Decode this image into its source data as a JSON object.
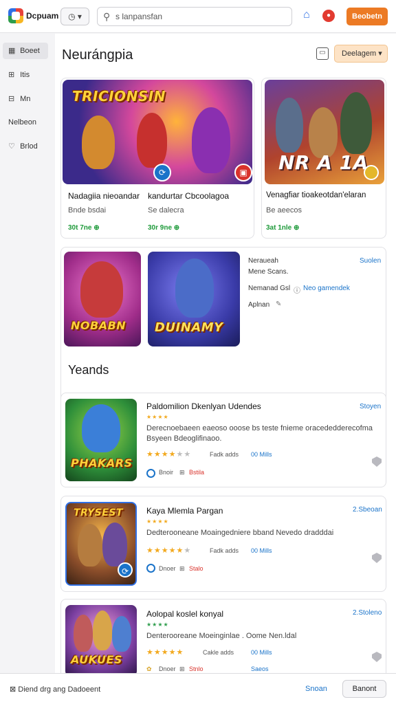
{
  "topbar": {
    "brand": "Dcpuam",
    "history_label": "◷ ▾",
    "search_placeholder": "s lanpansfan",
    "cta_label": "Beobetn"
  },
  "sidebar": {
    "items": [
      {
        "icon": "▦",
        "label": "Boeet"
      },
      {
        "icon": "⊞",
        "label": "Itis"
      },
      {
        "icon": "⊟",
        "label": "Mn"
      },
      {
        "icon": "",
        "label": "Nelbeon"
      },
      {
        "icon": "♡",
        "label": "Brlod"
      }
    ]
  },
  "main": {
    "title": "Neurángpia",
    "dropdown_label": "Deelagem ▾",
    "featured": [
      {
        "art_title": "TRICIONSIN",
        "name": "Nadagiia nieoandar",
        "dev": "Bnde bsdai",
        "price": "30t 7ne ⊕",
        "badge": "⟳"
      },
      {
        "art_title": "",
        "name": "kandurtar Cbcoolagoa",
        "dev": "Se dalecra",
        "price": "30r 9ne ⊕",
        "badge": "▣"
      },
      {
        "art_title": "NR A 1A",
        "name": "Venagfiar tioakeotdan'elaran",
        "dev": "Be aeecos",
        "price": "3at 1nle ⊕",
        "badge": ""
      }
    ],
    "promo": {
      "art1_title": "NOBABN",
      "art2_title": "DUINAMY",
      "info_title": "Neraueah",
      "info_line": "Mene Scans.",
      "row2_label": "Nemanad Gsl",
      "row2_link": "Neo gamendek",
      "row3_label": "Aplnan",
      "link": "Suolen"
    },
    "trends_title": "Yeands",
    "trends": [
      {
        "art_title": "PHAKARS",
        "name": "Paldomilion Dkenlyan Udendes",
        "desc": "Derecnoebaeen eaeoso ooose bs teste fnieme oracededderecofma Bsyeen Bdeoglifinaoo.",
        "link": "Stoyen",
        "score": "Fadk adds",
        "count": "00 Mills",
        "meta1": "Bnoir",
        "meta2": "Bstila",
        "rating_stars": "★★★★",
        "rating_off": "★★",
        "mini": "★★★★"
      },
      {
        "art_title": "TRYSEST",
        "name": "Kaya Mlemla Pargan",
        "desc": "Dedterooneane Moaingedniere bband Nevedo dradddai",
        "link": "2.Sbeoan",
        "score": "Fadk adds",
        "count": "00 Mills",
        "meta1": "Dnoer",
        "meta2": "Stalo",
        "rating_stars": "★★★★★",
        "rating_off": "★",
        "mini": "★★★★"
      },
      {
        "art_title": "AUKUES",
        "name": "Aolopal koslel konyal",
        "desc": "Denterooreane Moeinginlae . Oome Nen.ldal",
        "link": "2.Stoleno",
        "score": "Cakle adds",
        "count": "00 Mills",
        "meta1": "Dnoer",
        "meta2": "Stnlo",
        "meta3": "Saeos",
        "rating_stars": "★★★★★",
        "rating_off": "",
        "mini": "★★★★"
      }
    ]
  },
  "footer": {
    "left": "Diend drg ang Dadoeent",
    "link": "Snoan",
    "button": "Banont"
  },
  "colors": {
    "accent": "#ec7a24",
    "link": "#1a73c9",
    "price": "#1e9a3a",
    "star": "#f2a91e"
  }
}
